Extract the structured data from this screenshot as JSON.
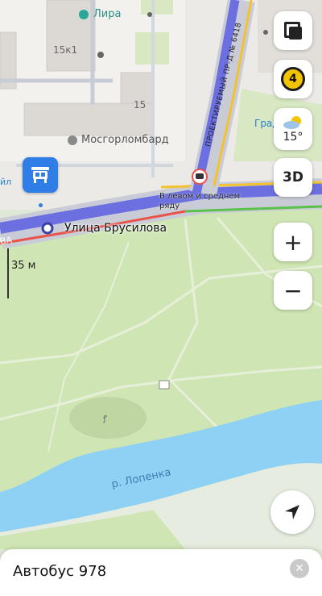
{
  "map": {
    "poi_lira": "Лира",
    "building_15k1": "15к1",
    "building_15": "15",
    "poi_mosgorlombard": "Мосгорломбард",
    "poi_grad_partial": "Град",
    "poi_yl_partial": "йл",
    "street_proektiruemy": "ПРОЕКТИРУЕМЫЙ ПР-Д № 6418",
    "street_brusilova": "Улица Брусилова",
    "street_left_partial": "ВА",
    "lane_hint": "В левом и среднем ряду",
    "river_label": "р. Лопенка",
    "scale_label": "35 м"
  },
  "controls": {
    "traffic_level": "4",
    "temperature": "15°",
    "mode_3d": "3D",
    "zoom_in": "+",
    "zoom_out": "−"
  },
  "sheet": {
    "title": "Автобус 978",
    "close_glyph": "✕"
  },
  "colors": {
    "park": "#cfe6b4",
    "water": "#8fd0f5",
    "route_blue": "#6b6fe0",
    "traffic_red": "#e8534a",
    "traffic_green": "#5ac24a",
    "road_yellow": "#f2c230",
    "stop_blue": "#2f7de6"
  }
}
